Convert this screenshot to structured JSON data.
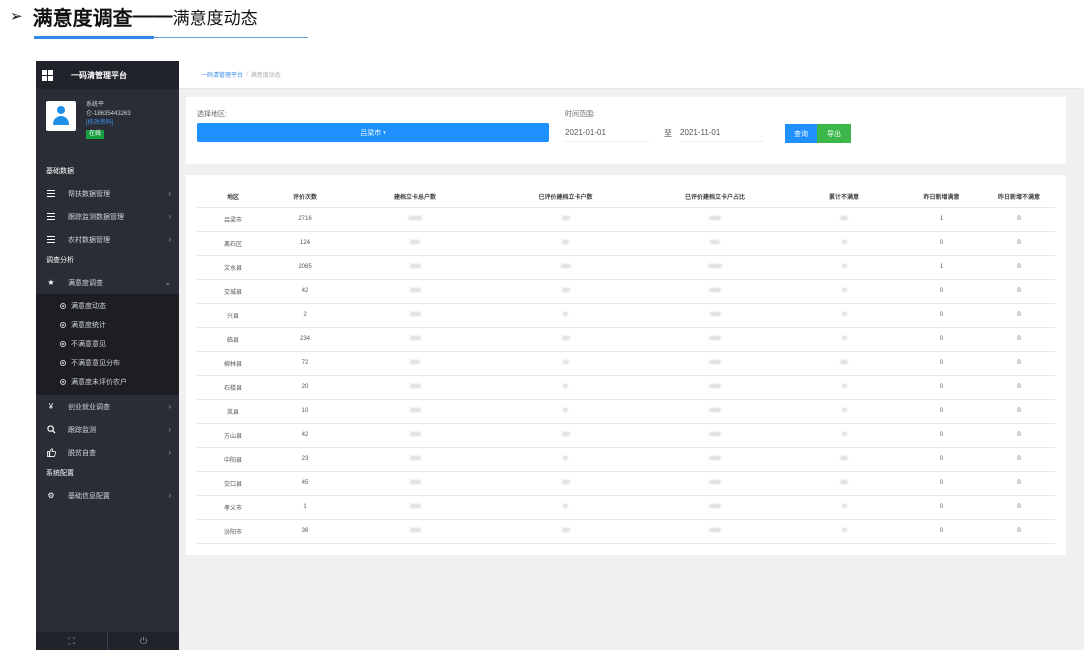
{
  "doc": {
    "arrow": "➢",
    "title_bold": "满意度调查",
    "title_dash": "——",
    "title_sub": "满意度动态"
  },
  "sidebar": {
    "app_title": "一码清管理平台",
    "user": {
      "name": "系统平",
      "phone": "仑-18635443263",
      "change_password": "[修改密码]",
      "status": "在线"
    },
    "sections": [
      {
        "title": "基础数据",
        "items": [
          {
            "label": "帮扶数据管理",
            "icon": "list-icon"
          },
          {
            "label": "跟踪监测数据管理",
            "icon": "list-icon"
          },
          {
            "label": "农村数据管理",
            "icon": "list-icon"
          }
        ]
      },
      {
        "title": "调查分析",
        "expanded_item": {
          "label": "满意度调查",
          "icon": "star-icon"
        },
        "sub_items": [
          "满意度动态",
          "满意度统计",
          "不满意意见",
          "不满意意见分布",
          "满意度未评价农户"
        ],
        "items": [
          {
            "label": "创业就业调查",
            "icon": "yen-icon"
          },
          {
            "label": "跟踪监测",
            "icon": "search-icon"
          },
          {
            "label": "脱贫自查",
            "icon": "thumb-icon"
          }
        ]
      },
      {
        "title": "系统配置",
        "items": [
          {
            "label": "基础信息配置",
            "icon": "gear-icon"
          }
        ]
      }
    ],
    "bottom": {
      "expand_icon": "⛶",
      "power_icon": "⏻"
    }
  },
  "main": {
    "breadcrumb": {
      "home": "一码清管理平台",
      "separator": "/",
      "current": "满意度动态"
    },
    "filter": {
      "region_label": "选择地区:",
      "region_value": "吕梁市",
      "time_label": "时间范围:",
      "date_from": "2021-01-01",
      "to_label": "至",
      "date_to": "2021-11-01",
      "query_button": "查询",
      "export_button": "导出"
    },
    "table": {
      "columns": [
        "地区",
        "评价次数",
        "建档立卡总户数",
        "已评价建档立卡户数",
        "已评价建档立卡户占比",
        "累计不满意",
        "昨日新增满意",
        "昨日新增不满意"
      ],
      "rows": [
        [
          "吕梁市",
          "2716",
          "1",
          "0"
        ],
        [
          "离石区",
          "124",
          "0",
          "0"
        ],
        [
          "文水县",
          "2065",
          "1",
          "0"
        ],
        [
          "交城县",
          "42",
          "0",
          "0"
        ],
        [
          "兴县",
          "2",
          "0",
          "0"
        ],
        [
          "临县",
          "234",
          "0",
          "0"
        ],
        [
          "柳林县",
          "72",
          "0",
          "0"
        ],
        [
          "石楼县",
          "20",
          "0",
          "0"
        ],
        [
          "岚县",
          "10",
          "0",
          "0"
        ],
        [
          "方山县",
          "42",
          "0",
          "0"
        ],
        [
          "中阳县",
          "23",
          "0",
          "0"
        ],
        [
          "交口县",
          "45",
          "0",
          "0"
        ],
        [
          "孝义市",
          "1",
          "0",
          "0"
        ],
        [
          "汾阳市",
          "36",
          "0",
          "0"
        ]
      ]
    }
  }
}
